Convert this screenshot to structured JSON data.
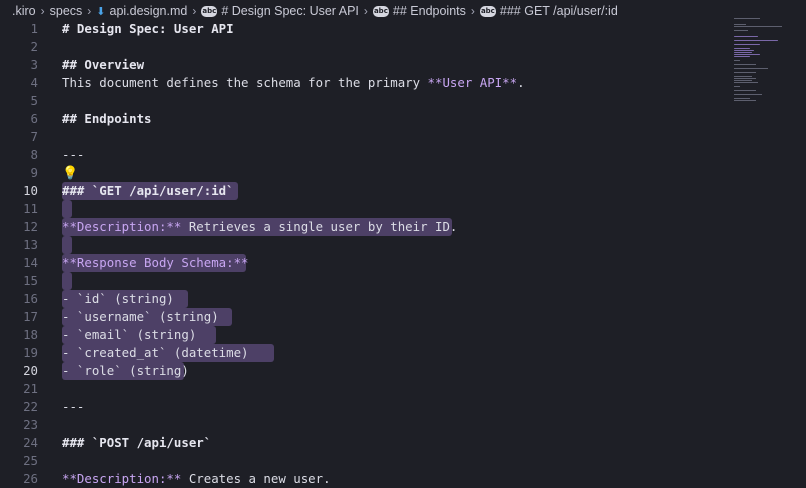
{
  "breadcrumb": {
    "items": [
      {
        "label": ".kiro"
      },
      {
        "label": "specs"
      },
      {
        "label": "api.design.md"
      },
      {
        "label": "# Design Spec: User API"
      },
      {
        "label": "## Endpoints"
      },
      {
        "label": "### GET /api/user/:id"
      }
    ],
    "colors": {
      "file_icon": "#4aa3e8",
      "text": "#c9cad6"
    }
  },
  "editor": {
    "current_line": 10,
    "selection_color": "#4d4066",
    "lines": [
      {
        "n": "1",
        "text": "# Design Spec: User API"
      },
      {
        "n": "2",
        "text": ""
      },
      {
        "n": "3",
        "text": "## Overview"
      },
      {
        "n": "4",
        "text": "This document defines the schema for the primary ",
        "bold_text": "**User API**",
        "tail": "."
      },
      {
        "n": "5",
        "text": ""
      },
      {
        "n": "6",
        "text": "## Endpoints"
      },
      {
        "n": "7",
        "text": ""
      },
      {
        "n": "8",
        "text": "---"
      },
      {
        "n": "9",
        "text": ""
      },
      {
        "n": "10",
        "text": "### `GET /api/user/:id`"
      },
      {
        "n": "11",
        "text": ""
      },
      {
        "n": "12",
        "bold_text": "**Description:**",
        "tail": " Retrieves a single user by their ID."
      },
      {
        "n": "13",
        "text": ""
      },
      {
        "n": "14",
        "bold_text": "**Response Body Schema:**"
      },
      {
        "n": "15",
        "text": ""
      },
      {
        "n": "16",
        "text": "- `id` (string)"
      },
      {
        "n": "17",
        "text": "- `username` (string)"
      },
      {
        "n": "18",
        "text": "- `email` (string)"
      },
      {
        "n": "19",
        "text": "- `created_at` (datetime)"
      },
      {
        "n": "20",
        "text": "- `role` (string)"
      },
      {
        "n": "21",
        "text": ""
      },
      {
        "n": "22",
        "text": "---"
      },
      {
        "n": "23",
        "text": ""
      },
      {
        "n": "24",
        "text": "### `POST /api/user`"
      },
      {
        "n": "25",
        "text": ""
      },
      {
        "n": "26",
        "bold_text": "**Description:**",
        "tail": " Creates a new user."
      }
    ]
  },
  "lightbulb": {
    "icon": "lightbulb-icon",
    "line": "9"
  }
}
